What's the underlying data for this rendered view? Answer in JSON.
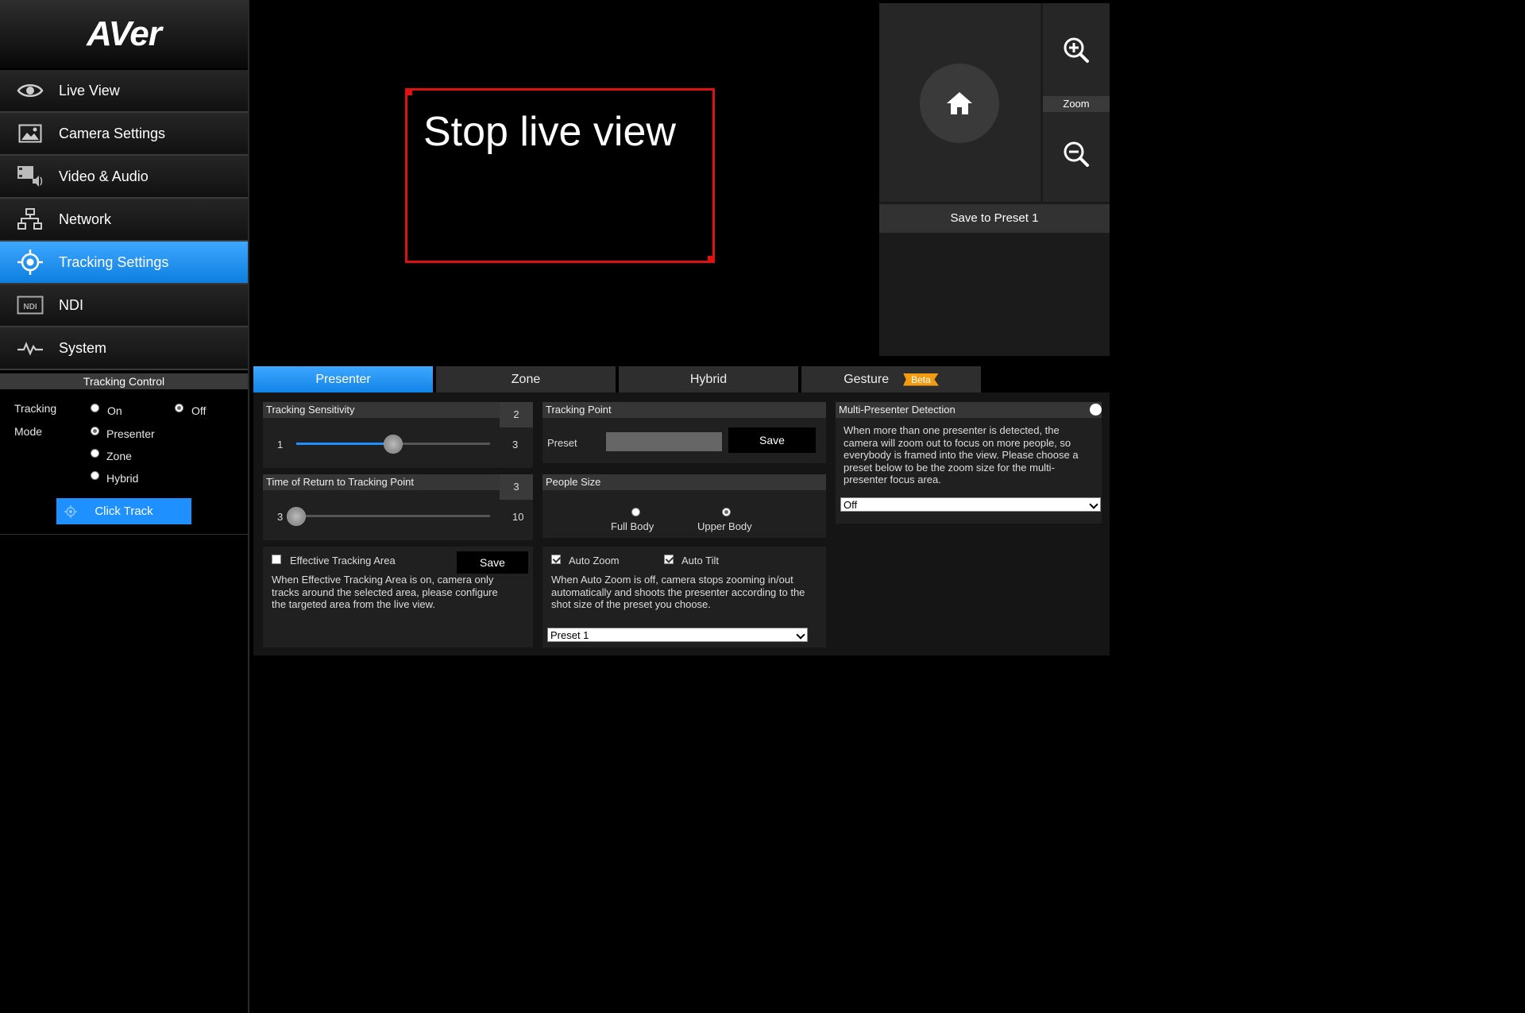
{
  "logo": {
    "text": "AVer"
  },
  "sidebar": {
    "items": [
      {
        "label": "Live View",
        "icon": "eye-icon"
      },
      {
        "label": "Camera Settings",
        "icon": "image-icon"
      },
      {
        "label": "Video & Audio",
        "icon": "video-audio-icon"
      },
      {
        "label": "Network",
        "icon": "network-icon"
      },
      {
        "label": "Tracking Settings",
        "icon": "crosshair-icon",
        "active": true
      },
      {
        "label": "NDI",
        "icon": "ndi-icon"
      },
      {
        "label": "System",
        "icon": "pulse-icon"
      }
    ]
  },
  "tracking_control": {
    "title": "Tracking Control",
    "tracking_label": "Tracking",
    "on_label": "On",
    "off_label": "Off",
    "tracking_value": "Off",
    "mode_label": "Mode",
    "modes": [
      "Presenter",
      "Zone",
      "Hybrid"
    ],
    "mode_value": "Presenter",
    "click_track_label": "Click Track"
  },
  "live_view": {
    "text": "Stop live view",
    "border_color": "#e01010"
  },
  "ptz": {
    "zoom_label": "Zoom",
    "save_preset_label": "Save to Preset 1"
  },
  "tabs": [
    {
      "label": "Presenter",
      "active": true
    },
    {
      "label": "Zone"
    },
    {
      "label": "Hybrid"
    },
    {
      "label": "Gesture",
      "badge": "Beta"
    }
  ],
  "tracking_sensitivity": {
    "title": "Tracking Sensitivity",
    "min": "1",
    "max": "3",
    "value": 2,
    "value_label": "2"
  },
  "return_time": {
    "title": "Time of Return to Tracking Point",
    "min": "3",
    "max": "10",
    "value": 3,
    "value_label": "3"
  },
  "tracking_point": {
    "title": "Tracking Point",
    "preset_label": "Preset",
    "save_label": "Save"
  },
  "people_size": {
    "title": "People Size",
    "options": [
      "Full Body",
      "Upper Body"
    ],
    "value": "Upper Body"
  },
  "effective_area": {
    "label": "Effective Tracking Area",
    "checked": false,
    "save_label": "Save",
    "desc_lines": [
      "When Effective Tracking Area is on, camera only",
      "tracks around the selected area, please configure",
      "the targeted area from the live view."
    ]
  },
  "auto": {
    "auto_zoom_label": "Auto Zoom",
    "auto_zoom_checked": true,
    "auto_tilt_label": "Auto Tilt",
    "auto_tilt_checked": true,
    "desc_lines": [
      "When Auto Zoom is off, camera stops zooming in/out",
      "automatically and shoots the presenter according to the",
      "shot size of the preset you choose."
    ],
    "preset_select": "Preset 1"
  },
  "multi_presenter": {
    "title": "Multi-Presenter Detection",
    "desc_lines": [
      "When more than one presenter is detected, the",
      "camera will zoom out to focus on more people, so",
      "everybody is framed into the view. Please choose a",
      "preset below to be the zoom size for the multi-",
      "presenter focus area."
    ],
    "select_value": "Off"
  },
  "colors": {
    "accent": "#1e90ff",
    "badge": "#f39c12"
  }
}
